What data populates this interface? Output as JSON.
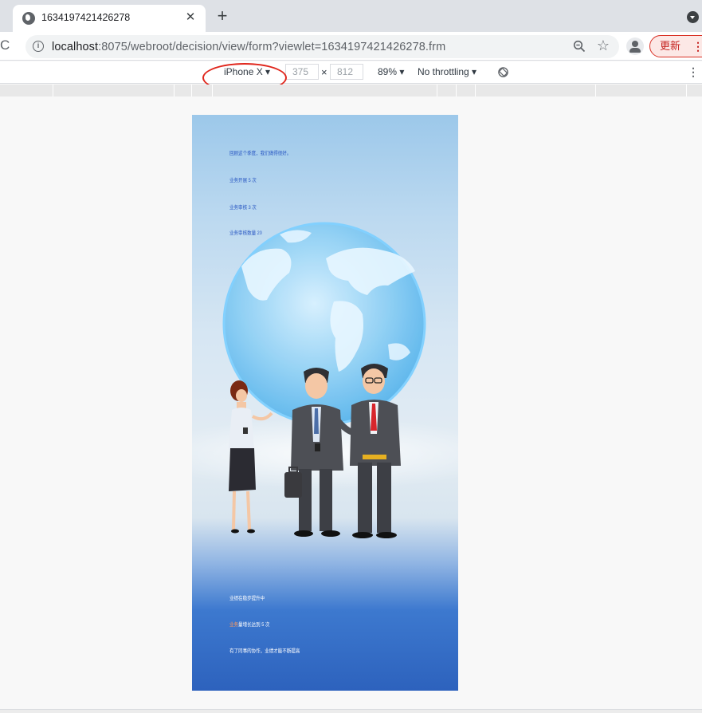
{
  "browser": {
    "tab_title": "1634197421426278",
    "close_glyph": "✕",
    "new_tab_glyph": "+",
    "reload_glyph": "C",
    "info_glyph": "i",
    "url_host": "localhost",
    "url_path": ":8075/webroot/decision/view/form?viewlet=1634197421426278.frm",
    "star_glyph": "☆",
    "update_label": "更新",
    "menu_glyph": "⋮"
  },
  "device_toolbar": {
    "device": "iPhone X",
    "width": "375",
    "height": "812",
    "times": "×",
    "zoom": "89%",
    "throttling": "No throttling",
    "more_glyph": "⋮"
  },
  "page": {
    "top_lines": [
      "回顾这个季度，我们做得很好。",
      "业务开展 5 次",
      "业务审核 3 次",
      "业务审核数量 20"
    ],
    "bottom_lines": [
      {
        "prefix": "",
        "text": "业绩在稳步提升中"
      },
      {
        "prefix": "业务",
        "text": "量增长达到 5 次"
      },
      {
        "prefix": "",
        "text": "有了同事的协作，业绩才能不断提高"
      }
    ]
  },
  "colors": {
    "highlight_ring": "#e0261c",
    "update_accent": "#c5221f",
    "top_text": "#2b59c3",
    "bottom_highlight": "#ff9a5c"
  }
}
